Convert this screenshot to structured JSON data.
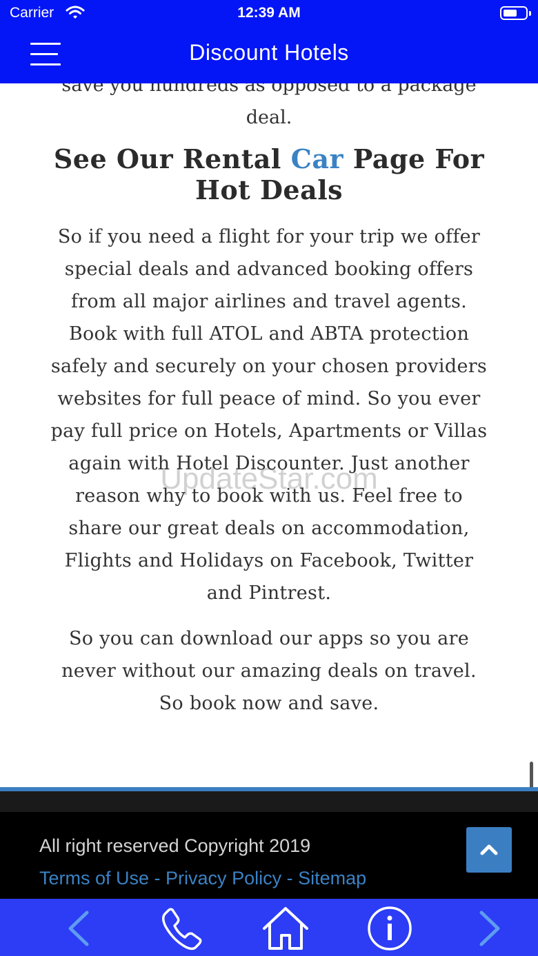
{
  "status_bar": {
    "carrier": "Carrier",
    "time": "12:39 AM",
    "battery_level": 0.62
  },
  "header": {
    "title": "Discount Hotels"
  },
  "article": {
    "intro_partial": "save you hundreds as opposed to a package deal.",
    "heading_before": "See Our Rental ",
    "heading_highlight": "Car",
    "heading_after": " Page For Hot Deals",
    "paragraph1": "So if you need a flight for your trip we offer special deals and advanced booking offers from all major airlines and travel agents. Book with full ATOL and ABTA protection safely and securely on your chosen providers websites for full peace of mind. So you ever pay full price on Hotels, Apartments or Villas again with Hotel Discounter. Just another reason why to book with us. Feel free to share our great deals on accommodation, Flights and Holidays on Facebook, Twitter and Pintrest.",
    "paragraph2": "So you can download our apps so you are never without our amazing deals on travel. So book now and save."
  },
  "watermark": "UpdateStar.com",
  "footer": {
    "copyright": "All right reserved Copyright 2019",
    "terms": "Terms of Use",
    "separator": " - ",
    "privacy": "Privacy Policy",
    "sitemap": "Sitemap"
  },
  "toolbar": {
    "items": [
      "back-icon",
      "phone-icon",
      "home-icon",
      "info-icon",
      "forward-icon"
    ]
  },
  "colors": {
    "header_bg": "#0416f5",
    "toolbar_bg": "#2c3df5",
    "accent": "#3b82c4",
    "footer_bg": "#000000"
  }
}
